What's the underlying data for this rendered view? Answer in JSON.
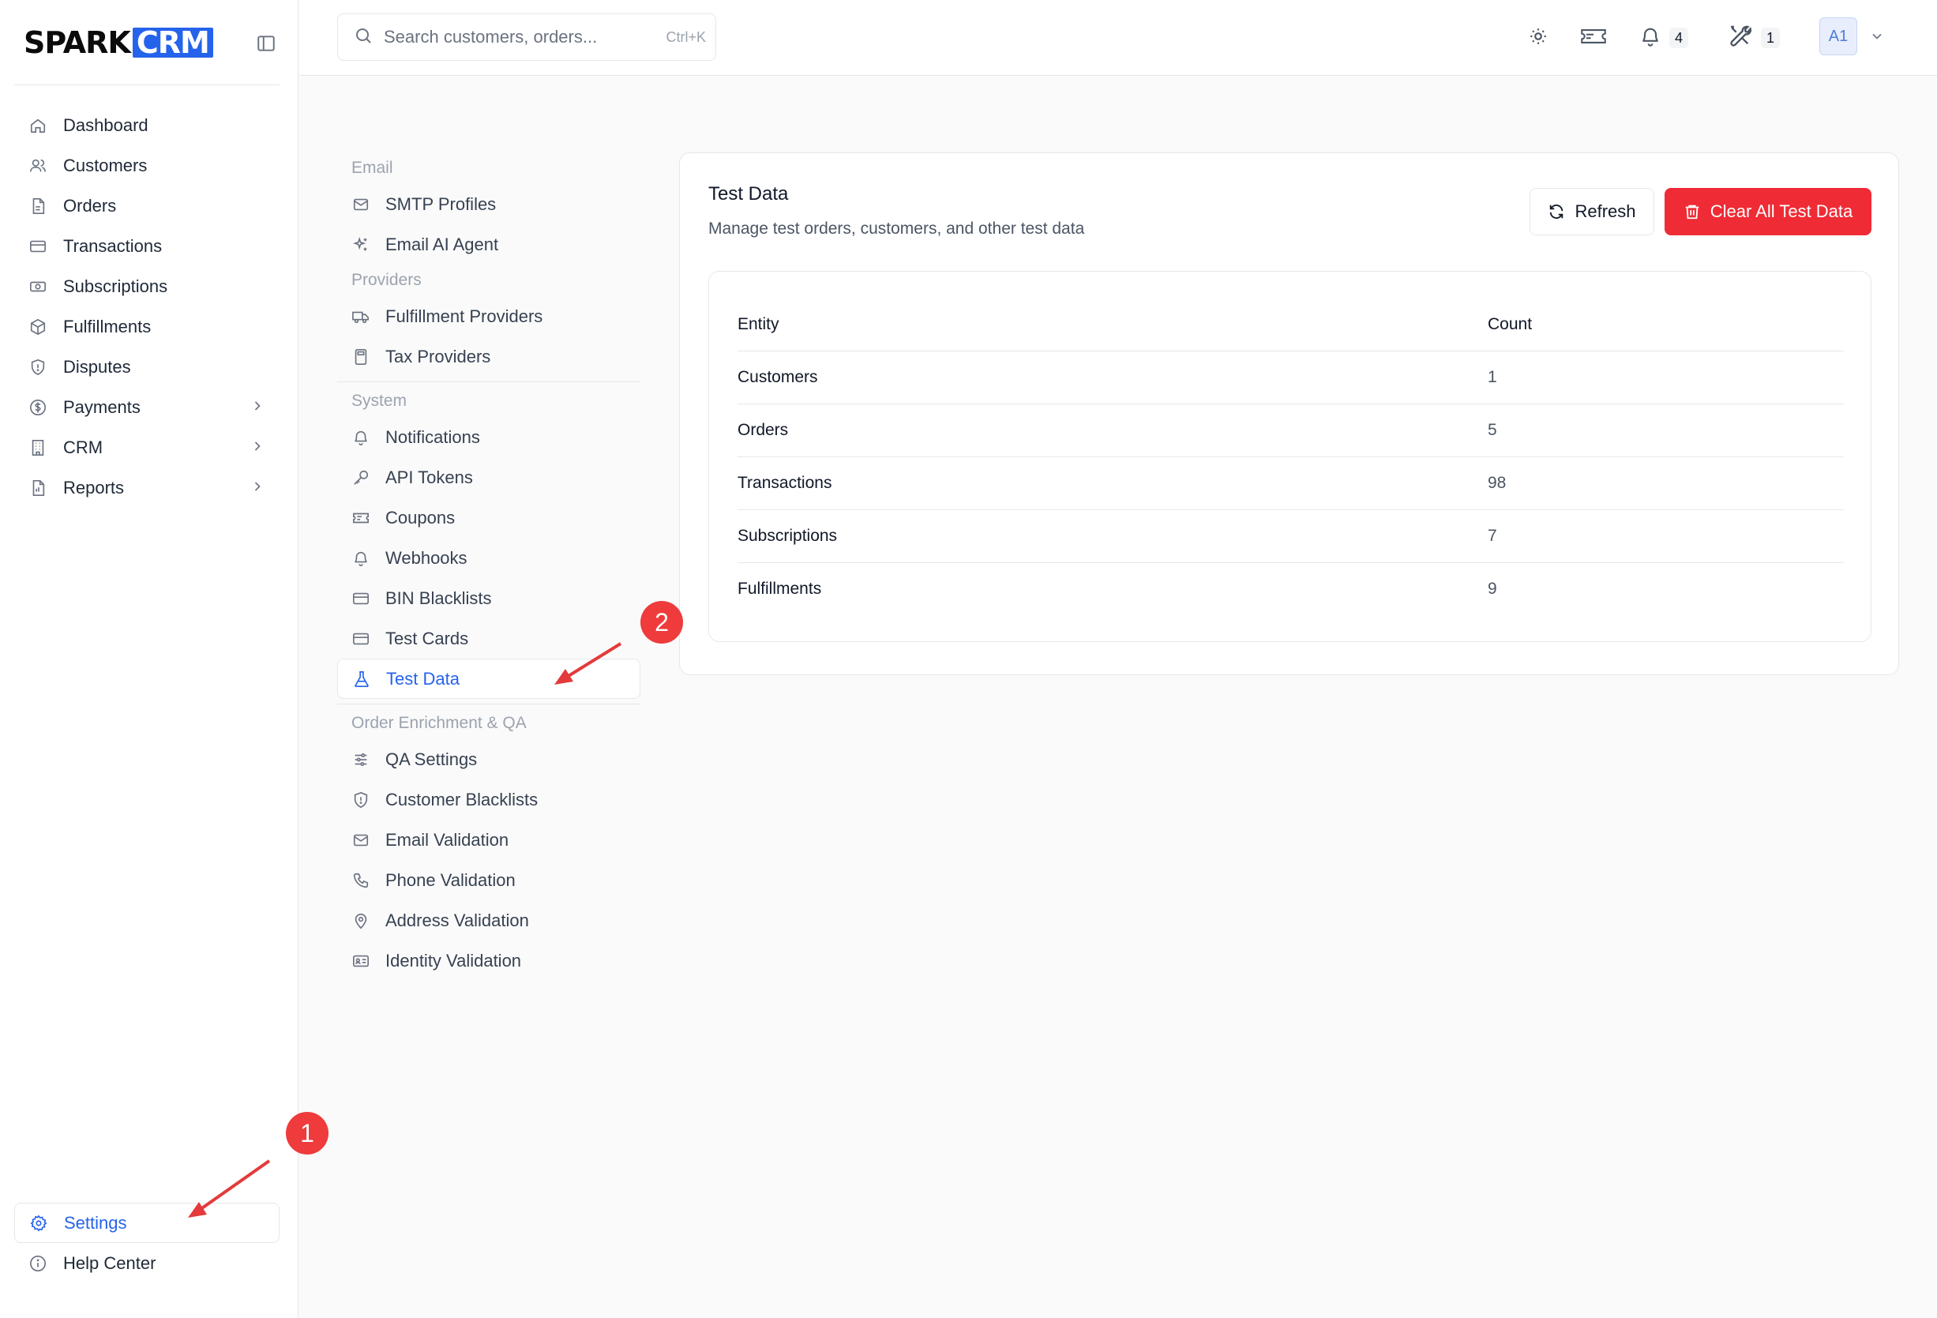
{
  "brand": {
    "part1": "SPARK",
    "part2": "CRM",
    "accent": "#2563eb"
  },
  "sidebar": {
    "items": [
      {
        "label": "Dashboard",
        "icon": "home-icon"
      },
      {
        "label": "Customers",
        "icon": "users-icon"
      },
      {
        "label": "Orders",
        "icon": "file-icon"
      },
      {
        "label": "Transactions",
        "icon": "credit-card-icon"
      },
      {
        "label": "Subscriptions",
        "icon": "banknote-icon"
      },
      {
        "label": "Fulfillments",
        "icon": "package-icon"
      },
      {
        "label": "Disputes",
        "icon": "shield-icon"
      },
      {
        "label": "Payments",
        "icon": "dollar-circle-icon",
        "expandable": true
      },
      {
        "label": "CRM",
        "icon": "building-icon",
        "expandable": true
      },
      {
        "label": "Reports",
        "icon": "report-icon",
        "expandable": true
      }
    ],
    "bottom": [
      {
        "label": "Settings",
        "icon": "gear-icon",
        "active": true
      },
      {
        "label": "Help Center",
        "icon": "info-icon"
      }
    ]
  },
  "topbar": {
    "search_placeholder": "Search customers, orders...",
    "search_shortcut": "Ctrl+K",
    "notifications_count": "4",
    "tools_count": "1",
    "avatar": "A1"
  },
  "settings_menu": {
    "sections": [
      {
        "title": "Email",
        "items": [
          {
            "label": "SMTP Profiles",
            "icon": "mail-icon"
          },
          {
            "label": "Email AI Agent",
            "icon": "sparkles-icon"
          }
        ]
      },
      {
        "title": "Providers",
        "items": [
          {
            "label": "Fulfillment Providers",
            "icon": "truck-icon"
          },
          {
            "label": "Tax Providers",
            "icon": "calculator-icon"
          }
        ]
      },
      {
        "title": "System",
        "items": [
          {
            "label": "Notifications",
            "icon": "bell-icon"
          },
          {
            "label": "API Tokens",
            "icon": "key-icon"
          },
          {
            "label": "Coupons",
            "icon": "ticket-icon"
          },
          {
            "label": "Webhooks",
            "icon": "bell-icon"
          },
          {
            "label": "BIN Blacklists",
            "icon": "credit-card-icon"
          },
          {
            "label": "Test Cards",
            "icon": "credit-card-icon"
          },
          {
            "label": "Test Data",
            "icon": "flask-icon",
            "active": true
          }
        ]
      },
      {
        "title": "Order Enrichment & QA",
        "items": [
          {
            "label": "QA Settings",
            "icon": "sliders-icon"
          },
          {
            "label": "Customer Blacklists",
            "icon": "shield-icon"
          },
          {
            "label": "Email Validation",
            "icon": "mail-icon"
          },
          {
            "label": "Phone Validation",
            "icon": "phone-icon"
          },
          {
            "label": "Address Validation",
            "icon": "map-pin-icon"
          },
          {
            "label": "Identity Validation",
            "icon": "id-card-icon"
          }
        ]
      }
    ]
  },
  "card": {
    "title": "Test Data",
    "subtitle": "Manage test orders, customers, and other test data",
    "refresh_label": "Refresh",
    "clear_label": "Clear All Test Data",
    "danger_color": "#ef2b35",
    "table": {
      "headers": [
        "Entity",
        "Count"
      ],
      "rows": [
        [
          "Customers",
          "1"
        ],
        [
          "Orders",
          "5"
        ],
        [
          "Transactions",
          "98"
        ],
        [
          "Subscriptions",
          "7"
        ],
        [
          "Fulfillments",
          "9"
        ]
      ]
    }
  },
  "annotations": {
    "step1": "1",
    "step2": "2",
    "color": "#ef3b3b"
  }
}
